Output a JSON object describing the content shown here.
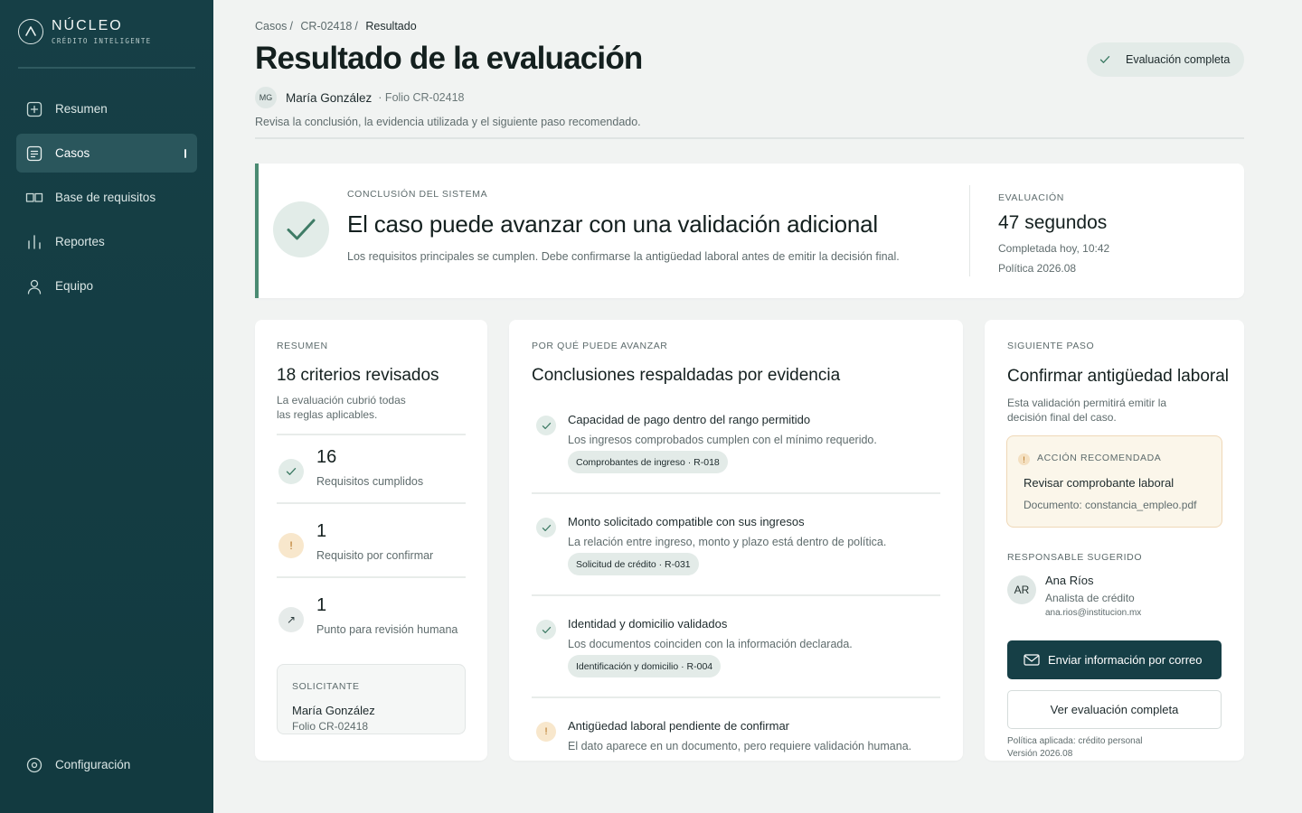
{
  "brand": {
    "name": "NÚCLEO",
    "tagline": "CRÉDITO INTELIGENTE"
  },
  "sidebar": {
    "items": [
      {
        "label": "Resumen",
        "icon": "plus-square-icon",
        "active": false
      },
      {
        "label": "Casos",
        "icon": "document-list-icon",
        "active": true
      },
      {
        "label": "Base de requisitos",
        "icon": "book-icon",
        "active": false
      },
      {
        "label": "Reportes",
        "icon": "bar-chart-icon",
        "active": false
      },
      {
        "label": "Equipo",
        "icon": "user-icon",
        "active": false
      }
    ],
    "settings_label": "Configuración"
  },
  "breadcrumb": {
    "items": [
      "Casos",
      "CR-02418",
      "Resultado"
    ],
    "separator": "/"
  },
  "header": {
    "title": "Resultado de la evaluación",
    "avatar_initials": "MG",
    "applicant_name": "María González",
    "folio": "· Folio CR-02418",
    "description": "Revisa la conclusión, la evidencia utilizada y el siguiente paso recomendado.",
    "status": "Evaluación completa"
  },
  "conclusion": {
    "label": "CONCLUSIÓN DEL SISTEMA",
    "title": "El caso puede avanzar con una validación adicional",
    "text": "Los requisitos principales se cumplen. Debe confirmarse la antigüedad laboral antes de emitir la decisión final.",
    "eval_label": "EVALUACIÓN",
    "eval_time": "47 segundos",
    "completed": "Completada hoy, 10:42",
    "policy": "Política 2026.08"
  },
  "summary": {
    "label": "RESUMEN",
    "title": "18 criterios revisados",
    "description": "La evaluación cubrió todas las reglas aplicables.",
    "stats": [
      {
        "value": "16",
        "label": "Requisitos cumplidos",
        "icon": "check-icon",
        "icon_glyph": ""
      },
      {
        "value": "1",
        "label": "Requisito por confirmar",
        "icon": "warning-icon",
        "icon_glyph": "!"
      },
      {
        "value": "1",
        "label": "Punto para revisión humana",
        "icon": "arrow-up-right-icon",
        "icon_glyph": "↗"
      }
    ],
    "applicant": {
      "label": "SOLICITANTE",
      "name": "María González",
      "folio": "Folio CR-02418"
    }
  },
  "evidence": {
    "label": "POR QUÉ PUEDE AVANZAR",
    "title": "Conclusiones respaldadas por evidencia",
    "items": [
      {
        "status": "ok",
        "title": "Capacidad de pago dentro del rango permitido",
        "text": "Los ingresos comprobados cumplen con el mínimo requerido.",
        "tag": "Comprobantes de ingreso · R-018"
      },
      {
        "status": "ok",
        "title": "Monto solicitado compatible con sus ingresos",
        "text": "La relación entre ingreso, monto y plazo está dentro de política.",
        "tag": "Solicitud de crédito · R-031"
      },
      {
        "status": "ok",
        "title": "Identidad y domicilio validados",
        "text": "Los documentos coinciden con la información declarada.",
        "tag": "Identificación y domicilio · R-004"
      },
      {
        "status": "pending",
        "title": "Antigüedad laboral pendiente de confirmar",
        "text": "El dato aparece en un documento, pero requiere validación humana.",
        "tag": ""
      }
    ]
  },
  "next_step": {
    "label": "SIGUIENTE PASO",
    "title": "Confirmar antigüedad laboral",
    "description": "Esta validación permitirá emitir la decisión final del caso.",
    "action": {
      "label": "ACCIÓN RECOMENDADA",
      "title": "Revisar comprobante laboral",
      "document": "Documento: constancia_empleo.pdf"
    },
    "responsible_label": "RESPONSABLE SUGERIDO",
    "responsible": {
      "initials": "AR",
      "name": "Ana Ríos",
      "role": "Analista de crédito",
      "email": "ana.rios@institucion.mx"
    },
    "primary_button": "Enviar información por correo",
    "secondary_button": "Ver evaluación completa",
    "policy_line1": "Política aplicada: crédito personal",
    "policy_line2": "Versión 2026.08"
  },
  "colors": {
    "sidebar": "#163f46",
    "accent_green": "#4a8a72",
    "warning": "#b06a12",
    "background": "#f1f3f2"
  }
}
